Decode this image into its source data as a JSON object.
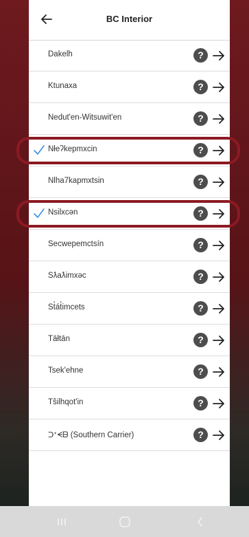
{
  "header": {
    "title": "BC Interior",
    "back_icon": "arrow-left-icon"
  },
  "languages": [
    {
      "label": "Dakelh",
      "checked": false
    },
    {
      "label": "Ktunaxa",
      "checked": false
    },
    {
      "label": "Nedut'en-Witsuwit'en",
      "checked": false
    },
    {
      "label": "Nłeʔkepmxcin",
      "checked": true
    },
    {
      "label": "Nlha7kapmxtsin",
      "checked": false
    },
    {
      "label": "Nsilxcən",
      "checked": true
    },
    {
      "label": "Secwepemctsín",
      "checked": false
    },
    {
      "label": "Sƛaƛimxəc",
      "checked": false
    },
    {
      "label": "St̓át̓imcets",
      "checked": false
    },
    {
      "label": "Tāłtān",
      "checked": false
    },
    {
      "label": "Tsek'ehne",
      "checked": false
    },
    {
      "label": "Tŝilhqot'in",
      "checked": false
    },
    {
      "label": "ᑐᐩᗕᗷ (Southern Carrier)",
      "checked": false
    }
  ],
  "row_icons": {
    "help": "help-circle-icon",
    "next": "arrow-right-icon",
    "check": "checkmark-icon"
  },
  "help_glyph": "?",
  "colors": {
    "highlight": "#8c1a22",
    "check": "#3a8ee6",
    "help_bg": "#4d4d4d"
  },
  "navbar": {
    "icons": [
      "recent-apps-icon",
      "home-icon",
      "back-icon"
    ]
  }
}
